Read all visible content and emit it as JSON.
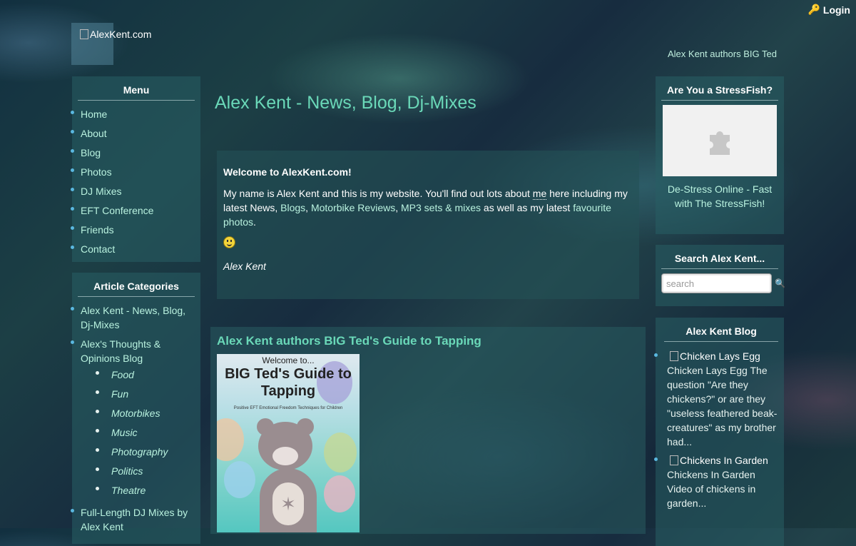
{
  "header": {
    "login_label": "Login",
    "logo_alt": "AlexKent.com",
    "ticker_text": "Alex Kent authors BIG Ted"
  },
  "menu": {
    "title": "Menu",
    "items": [
      {
        "label": "Home"
      },
      {
        "label": "About"
      },
      {
        "label": "Blog"
      },
      {
        "label": "Photos"
      },
      {
        "label": "DJ Mixes"
      },
      {
        "label": "EFT Conference"
      },
      {
        "label": "Friends"
      },
      {
        "label": "Contact"
      }
    ]
  },
  "categories": {
    "title": "Article Categories",
    "items": [
      {
        "label": "Alex Kent - News, Blog, Dj-Mixes"
      },
      {
        "label": "Alex's Thoughts & Opinions Blog"
      },
      {
        "label": "Full-Length DJ Mixes by Alex Kent"
      }
    ],
    "sub_items": [
      "Food",
      "Fun",
      "Motorbikes",
      "Music",
      "Photography",
      "Politics",
      "Theatre"
    ]
  },
  "main": {
    "page_title": "Alex Kent - News, Blog, Dj-Mixes",
    "welcome": {
      "heading": "Welcome to AlexKent.com!",
      "text_1": "My name is Alex Kent and this is my website. You'll find out lots about ",
      "link_me": "me",
      "text_2": " here including my latest News, ",
      "link_blogs": "Blogs",
      "text_3": ", ",
      "link_reviews": "Motorbike Reviews",
      "text_4": ", ",
      "link_mixes": "MP3 sets & mixes",
      "text_5": " as well as my latest ",
      "link_photos": "favourite photos",
      "text_6": ".",
      "signature": "Alex Kent"
    },
    "article": {
      "title": "Alex Kent authors BIG Ted's Guide to Tapping",
      "book_top": "Welcome to...",
      "book_title": "BIG Ted's Guide to Tapping",
      "book_subtitle": "Positive EFT Emotional Freedom Techniques for Children"
    }
  },
  "stressfish": {
    "title": "Are You a StressFish?",
    "link_text": "De-Stress Online - Fast with The StressFish!"
  },
  "search": {
    "title": "Search Alex Kent...",
    "placeholder": "search"
  },
  "blog": {
    "title": "Alex Kent Blog",
    "items": [
      {
        "img_alt": "Chicken Lays Egg",
        "text": "Chicken Lays Egg The question \"Are they chickens?\" or are they \"useless feathered beak-creatures\" as my brother had..."
      },
      {
        "img_alt": "Chickens In Garden",
        "text": "Chickens In Garden Video of chickens in garden..."
      }
    ]
  },
  "colors": {
    "accent": "#6ad8b8",
    "link": "#b9f2df",
    "panel": "#2a5f64",
    "bullet": "#5ab8e0"
  }
}
